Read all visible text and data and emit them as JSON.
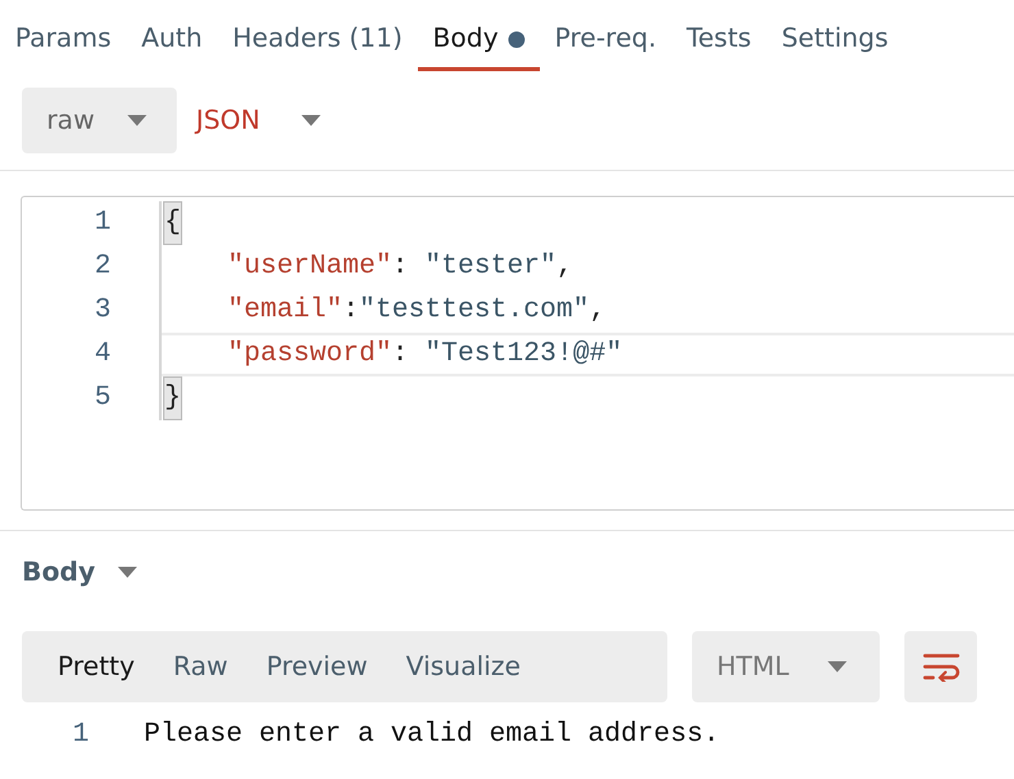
{
  "tabs": [
    {
      "label": "Params",
      "selected": false,
      "dot": false
    },
    {
      "label": "Auth",
      "selected": false,
      "dot": false
    },
    {
      "label": "Headers (11)",
      "selected": false,
      "dot": false
    },
    {
      "label": "Body",
      "selected": true,
      "dot": true
    },
    {
      "label": "Pre-req.",
      "selected": false,
      "dot": false
    },
    {
      "label": "Tests",
      "selected": false,
      "dot": false
    },
    {
      "label": "Settings",
      "selected": false,
      "dot": false
    }
  ],
  "body_mode": {
    "value": "raw"
  },
  "body_format": {
    "value": "JSON"
  },
  "editor": {
    "lines": [
      {
        "number": "1",
        "active": false,
        "tokens": [
          {
            "kind": "bracket",
            "text": "{",
            "matched": true
          }
        ],
        "children": [
          {
            "number": "2",
            "active": false,
            "tokens": [
              {
                "kind": "key",
                "text": "\"userName\""
              },
              {
                "kind": "punct",
                "text": ": "
              },
              {
                "kind": "string",
                "text": "\"tester\""
              },
              {
                "kind": "punct",
                "text": ","
              }
            ]
          },
          {
            "number": "3",
            "active": false,
            "tokens": [
              {
                "kind": "key",
                "text": "\"email\""
              },
              {
                "kind": "punct",
                "text": ":"
              },
              {
                "kind": "string",
                "text": "\"testtest.com\""
              },
              {
                "kind": "punct",
                "text": ","
              }
            ]
          },
          {
            "number": "4",
            "active": true,
            "tokens": [
              {
                "kind": "key",
                "text": "\"password\""
              },
              {
                "kind": "punct",
                "text": ": "
              },
              {
                "kind": "string",
                "text": "\"Test123!@#\""
              }
            ]
          }
        ]
      },
      {
        "number": "5",
        "active": false,
        "tokens": [
          {
            "kind": "bracket",
            "text": "}",
            "matched": true
          }
        ]
      }
    ]
  },
  "response": {
    "title": "Body",
    "views": [
      {
        "label": "Pretty",
        "selected": true
      },
      {
        "label": "Raw",
        "selected": false
      },
      {
        "label": "Preview",
        "selected": false
      },
      {
        "label": "Visualize",
        "selected": false
      }
    ],
    "language": "HTML",
    "wrap": true,
    "lines": [
      {
        "number": "1",
        "text": "Please enter a valid email address."
      }
    ]
  }
}
